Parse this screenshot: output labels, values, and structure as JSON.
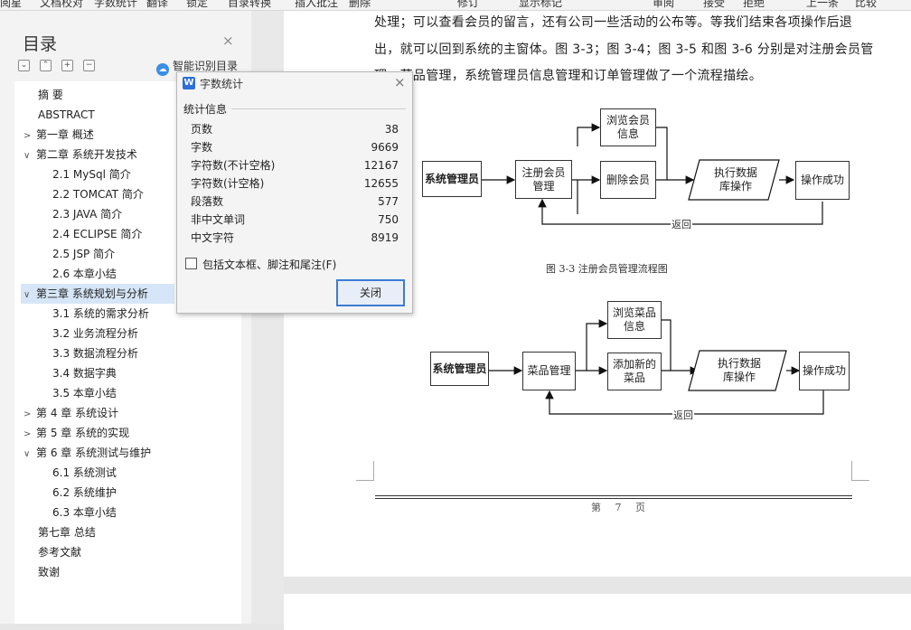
{
  "ribbon": {
    "items": [
      "阅星",
      "文档校对",
      "字数统计",
      "翻译",
      "锁定",
      "目录转换",
      "插入批注",
      "删除",
      "修订",
      "显示标记",
      "审阅",
      "接受",
      "拒绝",
      "上一条",
      "比较"
    ]
  },
  "toc": {
    "title": "目录",
    "smart_label": "智能识别目录",
    "buttons": [
      "⌄",
      "⌃",
      "+",
      "−"
    ],
    "items": [
      {
        "label": "摘 要"
      },
      {
        "label": "ABSTRACT"
      },
      {
        "label": "第一章 概述",
        "chev": ">"
      },
      {
        "label": "第二章  系统开发技术",
        "chev": "v"
      },
      {
        "label": "2.1 MySql 简介"
      },
      {
        "label": "2.2 TOMCAT 简介"
      },
      {
        "label": "2.3 JAVA  简介"
      },
      {
        "label": "2.4 ECLIPSE 简介"
      },
      {
        "label": "2.5 JSP 简介"
      },
      {
        "label": "2.6  本章小结"
      },
      {
        "label": "第三章  系统规划与分析",
        "chev": "v"
      },
      {
        "label": "3.1  系统的需求分析"
      },
      {
        "label": "3.2  业务流程分析"
      },
      {
        "label": "3.3  数据流程分析"
      },
      {
        "label": "3.4  数据字典"
      },
      {
        "label": "3.5  本章小结"
      },
      {
        "label": "第 4 章  系统设计",
        "chev": ">"
      },
      {
        "label": "第  5  章  系统的实现",
        "chev": ">"
      },
      {
        "label": "第  6  章   系统测试与维护",
        "chev": "v"
      },
      {
        "label": "6.1  系统测试"
      },
      {
        "label": "6.2  系统维护"
      },
      {
        "label": "6.3  本章小结"
      },
      {
        "label": "第七章   总结"
      },
      {
        "label": "参考文献"
      },
      {
        "label": "致谢"
      }
    ]
  },
  "document": {
    "lines": [
      "处理；可以查看会员的留言，还有公司一些活动的公布等。等我们结束各项操作后退",
      "出，就可以回到系统的主窗体。图 3-3；图 3-4；图 3-5 和图 3-6 分别是对注册会员管",
      "理、菜品管理，系统管理员信息管理和订单管理做了一个流程描绘。"
    ],
    "diagram1": {
      "admin": "系统管理员",
      "register": "注册会员\n管理",
      "browse": "浏览会员\n信息",
      "delete": "删除会员",
      "execute": "执行数据\n库操作",
      "success": "操作成功",
      "return": "返回"
    },
    "caption1": "图 3-3  注册会员管理流程图",
    "diagram2": {
      "admin": "系统管理员",
      "menu": "菜品管理",
      "browse": "浏览菜品\n信息",
      "add": "添加新的\n菜品",
      "execute": "执行数据\n库操作",
      "success": "操作成功",
      "return": "返回"
    },
    "footer": "第 7 页"
  },
  "dialog": {
    "title": "字数统计",
    "section": "统计信息",
    "stats": [
      {
        "label": "页数",
        "value": "38"
      },
      {
        "label": "字数",
        "value": "9669"
      },
      {
        "label": "字符数(不计空格)",
        "value": "12167"
      },
      {
        "label": "字符数(计空格)",
        "value": "12655"
      },
      {
        "label": "段落数",
        "value": "577"
      },
      {
        "label": "非中文单词",
        "value": "750"
      },
      {
        "label": "中文字符",
        "value": "8919"
      }
    ],
    "checkbox_label": "包括文本框、脚注和尾注(F)",
    "close_button": "关闭"
  }
}
